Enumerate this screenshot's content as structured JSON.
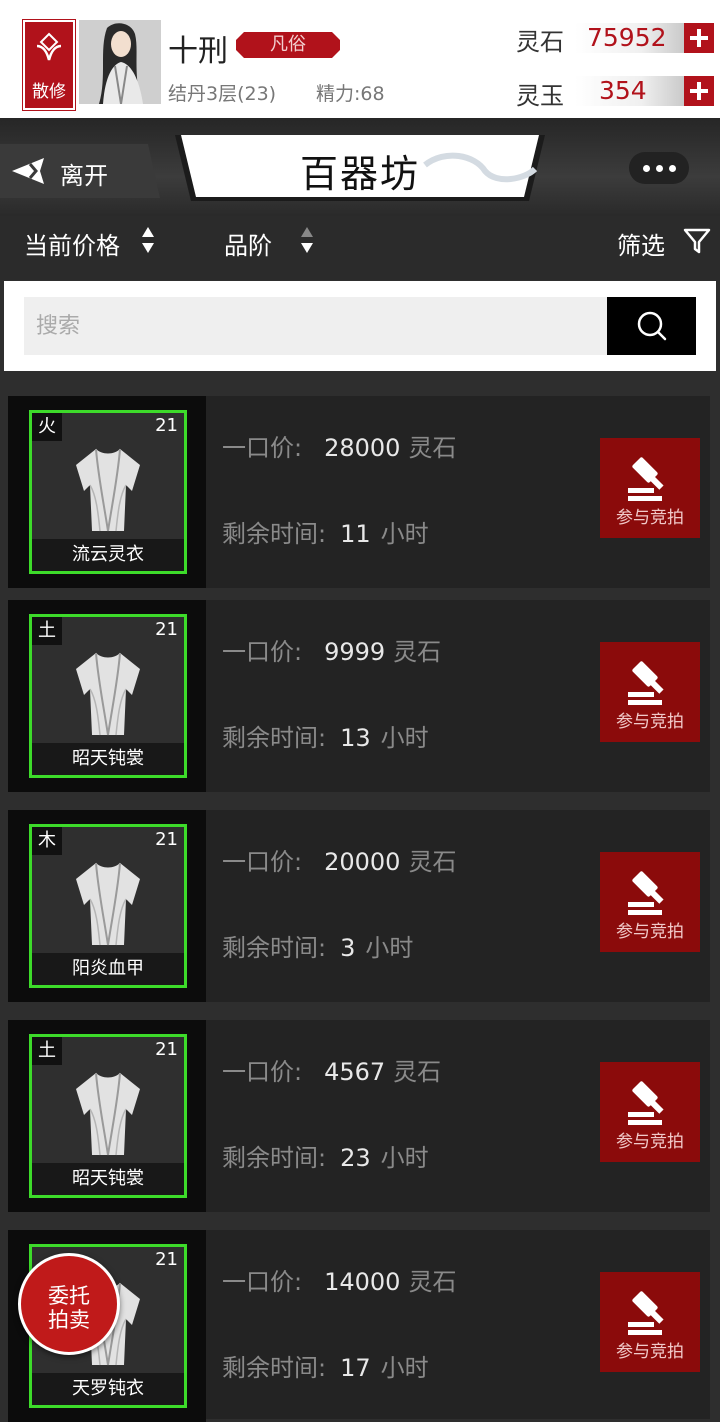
{
  "player": {
    "sect_label": "散修",
    "name": "十刑",
    "realm_tag": "凡俗",
    "cultivation": "结丹3层(23)",
    "energy": "精力:68"
  },
  "currencies": [
    {
      "label": "灵石",
      "value": "75952"
    },
    {
      "label": "灵玉",
      "value": "354"
    }
  ],
  "titlebar": {
    "back_label": "离开",
    "title": "百器坊"
  },
  "sortbar": {
    "price_sort": "当前价格",
    "grade_sort": "品阶",
    "filter": "筛选"
  },
  "search": {
    "placeholder": "搜索"
  },
  "listing_labels": {
    "price_label": "一口价:",
    "time_label": "剩余时间:",
    "currency": "灵石",
    "hours": "小时",
    "bid": "参与竞拍"
  },
  "listings": [
    {
      "element": "火",
      "level": "21",
      "name": "流云灵衣",
      "price": "28000",
      "hours": "11"
    },
    {
      "element": "土",
      "level": "21",
      "name": "昭天钝裳",
      "price": "9999",
      "hours": "13"
    },
    {
      "element": "木",
      "level": "21",
      "name": "阳炎血甲",
      "price": "20000",
      "hours": "3"
    },
    {
      "element": "土",
      "level": "21",
      "name": "昭天钝裳",
      "price": "4567",
      "hours": "23"
    },
    {
      "element": "",
      "level": "21",
      "name": "天罗钝衣",
      "price": "14000",
      "hours": "17"
    }
  ],
  "consign": {
    "line1": "委托",
    "line2": "拍卖"
  },
  "colors": {
    "accent_red": "#b1121b",
    "rarity_green": "#3ddb2a",
    "bid_red": "#8b0b0b"
  }
}
